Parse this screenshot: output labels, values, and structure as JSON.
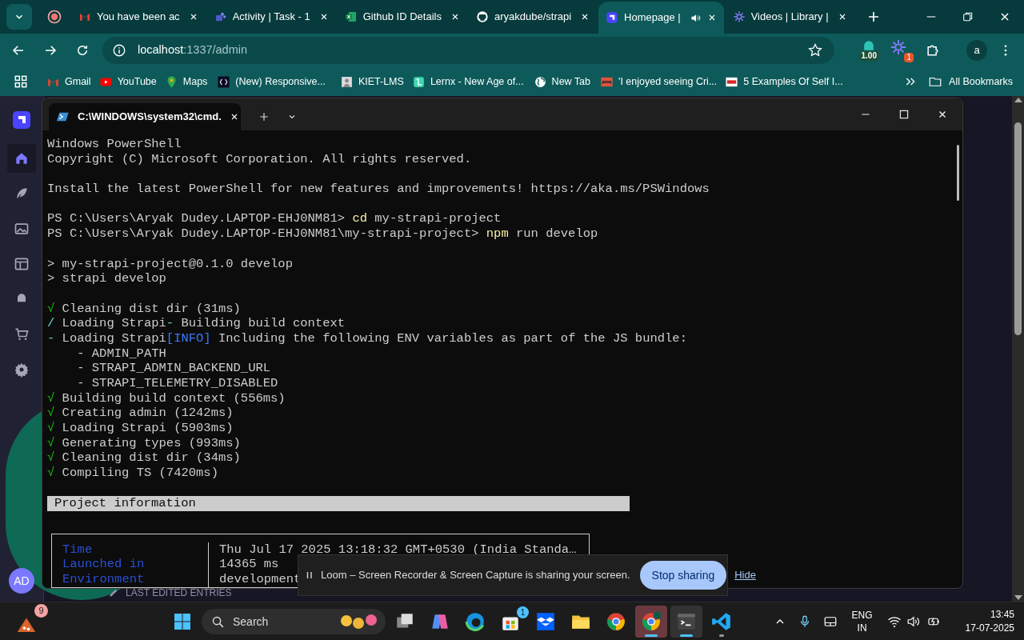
{
  "browser": {
    "tabs": [
      {
        "kind": "mail",
        "title": "You have been ac",
        "selected": false,
        "audio": false
      },
      {
        "kind": "people",
        "title": "Activity | Task - 1",
        "selected": false,
        "audio": false
      },
      {
        "kind": "sheet",
        "title": "Github ID Details",
        "selected": false,
        "audio": false
      },
      {
        "kind": "octocat",
        "title": "aryakdube/strapi",
        "selected": false,
        "audio": false
      },
      {
        "kind": "cube",
        "title": "Homepage |",
        "selected": true,
        "audio": true
      },
      {
        "kind": "burst",
        "title": "Videos | Library |",
        "selected": false,
        "audio": false
      }
    ],
    "address": {
      "host": "localhost",
      "path": ":1337/admin"
    },
    "extensions": [
      {
        "kind": "meter",
        "badge": "1.00"
      },
      {
        "kind": "burst",
        "badge": "1"
      }
    ],
    "profile": "a",
    "bookmarks": [
      {
        "kind": "mail",
        "label": "Gmail"
      },
      {
        "kind": "play",
        "label": "YouTube"
      },
      {
        "kind": "pin",
        "label": "Maps"
      },
      {
        "kind": "code",
        "label": "(New) Responsive..."
      },
      {
        "kind": "portrait",
        "label": "KIET-LMS"
      },
      {
        "kind": "book",
        "label": "Lernx - New Age of..."
      },
      {
        "kind": "globe",
        "label": "New Tab"
      },
      {
        "kind": "sofa",
        "label": "'I enjoyed seeing Cri..."
      },
      {
        "kind": "msi",
        "label": "5 Examples Of Self I..."
      }
    ],
    "all_bookmarks": "All Bookmarks"
  },
  "strapi": {
    "nav": [
      {
        "kind": "home",
        "selected": true
      },
      {
        "kind": "feather",
        "selected": false
      },
      {
        "kind": "images",
        "selected": false
      },
      {
        "kind": "layout",
        "selected": false
      },
      {
        "kind": "plugin",
        "selected": false
      },
      {
        "kind": "cart",
        "selected": false
      },
      {
        "kind": "gear",
        "selected": false
      }
    ],
    "avatar": "AD",
    "section_title": "LAST EDITED ENTRIES"
  },
  "terminal": {
    "tab_title": "C:\\WINDOWS\\system32\\cmd.",
    "blocks": [
      [
        [
          {
            "kind": "text",
            "text": "Windows PowerShell"
          }
        ],
        [
          {
            "kind": "text",
            "text": "Copyright (C) Microsoft Corporation. All rights reserved."
          }
        ]
      ],
      [
        [
          {
            "kind": "text",
            "text": "Install the latest PowerShell for new features and improvements! https://aka.ms/PSWindows"
          }
        ]
      ],
      [
        [
          {
            "kind": "text",
            "text": "PS C:\\Users\\Aryak Dudey.LAPTOP-EHJ0NM81> "
          },
          {
            "kind": "command",
            "text": "cd"
          },
          {
            "kind": "text",
            "text": " my-strapi-project"
          }
        ],
        [
          {
            "kind": "text",
            "text": "PS C:\\Users\\Aryak Dudey.LAPTOP-EHJ0NM81\\my-strapi-project> "
          },
          {
            "kind": "command",
            "text": "npm"
          },
          {
            "kind": "text",
            "text": " run develop"
          }
        ]
      ],
      [
        [
          {
            "kind": "text",
            "text": "> my-strapi-project@0.1.0 develop"
          }
        ],
        [
          {
            "kind": "text",
            "text": "> strapi develop"
          }
        ]
      ],
      [
        [
          {
            "kind": "check",
            "text": "√"
          },
          {
            "kind": "text",
            "text": " Cleaning dist dir (31ms)"
          }
        ],
        [
          {
            "kind": "spinner",
            "text": "/"
          },
          {
            "kind": "text",
            "text": " Loading Strapi"
          },
          {
            "kind": "spinner",
            "text": "-"
          },
          {
            "kind": "text",
            "text": " Building build context"
          }
        ],
        [
          {
            "kind": "spinner",
            "text": "-"
          },
          {
            "kind": "text",
            "text": " Loading Strapi"
          },
          {
            "kind": "tag",
            "text": "[INFO]"
          },
          {
            "kind": "text",
            "text": " Including the following ENV variables as part of the JS bundle:"
          }
        ],
        [
          {
            "kind": "text",
            "text": "    - ADMIN_PATH"
          }
        ],
        [
          {
            "kind": "text",
            "text": "    - STRAPI_ADMIN_BACKEND_URL"
          }
        ],
        [
          {
            "kind": "text",
            "text": "    - STRAPI_TELEMETRY_DISABLED"
          }
        ],
        [
          {
            "kind": "check",
            "text": "√"
          },
          {
            "kind": "text",
            "text": " Building build context (556ms)"
          }
        ],
        [
          {
            "kind": "check",
            "text": "√"
          },
          {
            "kind": "text",
            "text": " Creating admin (1242ms)"
          }
        ],
        [
          {
            "kind": "check",
            "text": "√"
          },
          {
            "kind": "text",
            "text": " Loading Strapi (5903ms)"
          }
        ],
        [
          {
            "kind": "check",
            "text": "√"
          },
          {
            "kind": "text",
            "text": " Generating types (993ms)"
          }
        ],
        [
          {
            "kind": "check",
            "text": "√"
          },
          {
            "kind": "text",
            "text": " Cleaning dist dir (34ms)"
          }
        ],
        [
          {
            "kind": "check",
            "text": "√"
          },
          {
            "kind": "text",
            "text": " Compiling TS (7420ms)"
          }
        ]
      ]
    ],
    "banner": "Project information",
    "info_rows": [
      {
        "label": "Time",
        "value": "Thu Jul 17 2025 13:18:32 GMT+0530 (India Standa…"
      },
      {
        "label": "Launched in",
        "value": "14365 ms"
      },
      {
        "label": "Environment",
        "value": "development"
      }
    ]
  },
  "loom": {
    "message": "Loom – Screen Recorder & Screen Capture is sharing your screen.",
    "stop": "Stop sharing",
    "hide": "Hide"
  },
  "taskbar": {
    "weather_badge": "9",
    "search": "Search",
    "apps": [
      {
        "kind": "taskview",
        "running": false,
        "selected": false
      },
      {
        "kind": "copilot",
        "running": false,
        "selected": false
      },
      {
        "kind": "edge",
        "running": false,
        "selected": false
      },
      {
        "kind": "store",
        "running": false,
        "selected": false,
        "badge": "1"
      },
      {
        "kind": "dropbox",
        "running": false,
        "selected": false
      },
      {
        "kind": "folder",
        "running": false,
        "selected": false
      },
      {
        "kind": "chrome",
        "running": false,
        "selected": false
      },
      {
        "kind": "chrome_profile",
        "running": true,
        "selected": true
      },
      {
        "kind": "terminal",
        "running": true,
        "selected": true
      },
      {
        "kind": "vscode",
        "running": true,
        "selected": false
      }
    ],
    "language": [
      "ENG",
      "IN"
    ],
    "time": "13:45",
    "date": "17-07-2025"
  }
}
